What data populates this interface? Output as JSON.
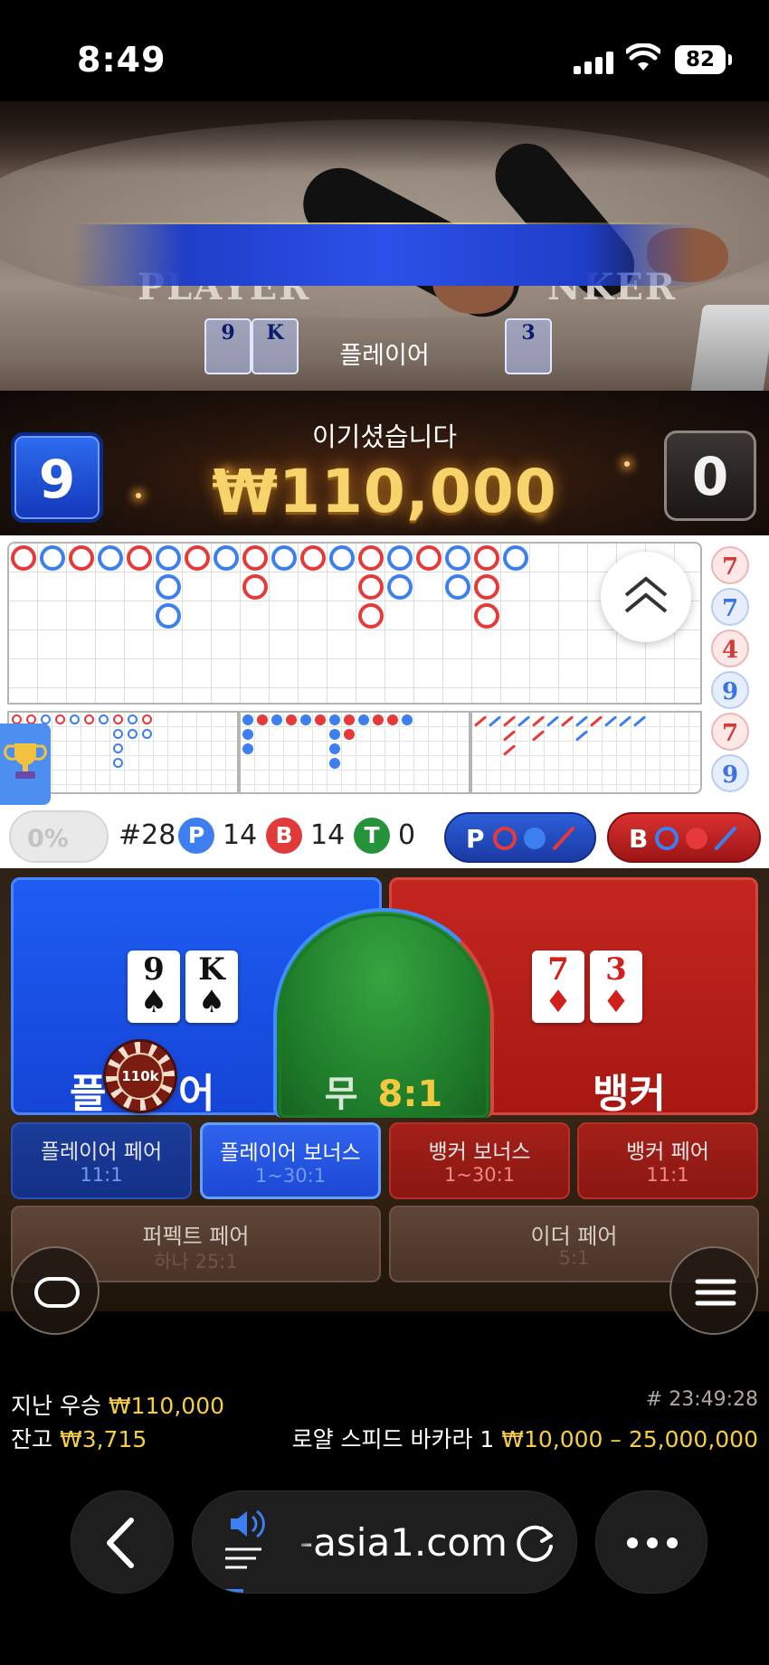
{
  "status_bar": {
    "time": "8:49",
    "battery": "82"
  },
  "video": {
    "table_player_text": "PLAYER",
    "table_banker_text": "NKER",
    "banner": "플레이어",
    "peek_cards": [
      "9",
      "K",
      "3"
    ],
    "player_score": "9",
    "banker_score": "0",
    "result_message": "이기셨습니다",
    "win_amount": "₩110,000"
  },
  "roadmap": {
    "percent": "0%",
    "side_column": [
      {
        "value": "7",
        "side": "banker"
      },
      {
        "value": "7",
        "side": "player"
      },
      {
        "value": "4",
        "side": "banker"
      },
      {
        "value": "9",
        "side": "player"
      },
      {
        "value": "7",
        "side": "banker"
      },
      {
        "value": "9",
        "side": "player"
      }
    ]
  },
  "stats": {
    "shoe_number": "#28",
    "player_label": "P",
    "player_count": "14",
    "banker_label": "B",
    "banker_count": "14",
    "tie_label": "T",
    "tie_count": "0",
    "predict_player_label": "P",
    "predict_banker_label": "B"
  },
  "bets": {
    "player": {
      "label_left": "플",
      "label_right": "어",
      "cards": [
        {
          "rank": "9",
          "suit": "♠"
        },
        {
          "rank": "K",
          "suit": "♠"
        }
      ]
    },
    "tie": {
      "label": "무",
      "odds": "8:1"
    },
    "banker": {
      "label": "뱅커",
      "cards": [
        {
          "rank": "7",
          "suit": "♦"
        },
        {
          "rank": "3",
          "suit": "♦"
        }
      ]
    },
    "chip": "110k",
    "side_bets": [
      {
        "name": "플레이어 페어",
        "odds": "11:1"
      },
      {
        "name": "플레이어 보너스",
        "odds": "1~30:1"
      },
      {
        "name": "뱅커 보너스",
        "odds": "1~30:1"
      },
      {
        "name": "뱅커 페어",
        "odds": "11:1"
      }
    ],
    "perfect_pair": {
      "name": "퍼펙트 페어",
      "odds": "하나 25:1"
    },
    "either_pair": {
      "name": "이더 페어",
      "odds": "5:1"
    }
  },
  "info": {
    "last_win_label": "지난 우승",
    "last_win_value": "₩110,000",
    "balance_label": "잔고",
    "balance_value": "₩3,715",
    "round_id": "# 23:49:28",
    "table_name": "로얄 스피드 바카라 1",
    "limits": "₩10,000 – 25,000,000"
  },
  "browser": {
    "url": "-asia1.com"
  },
  "colors": {
    "player": "#1e5df2",
    "banker": "#c42620",
    "tie": "#1d7a28",
    "gold": "#f5cd44"
  }
}
